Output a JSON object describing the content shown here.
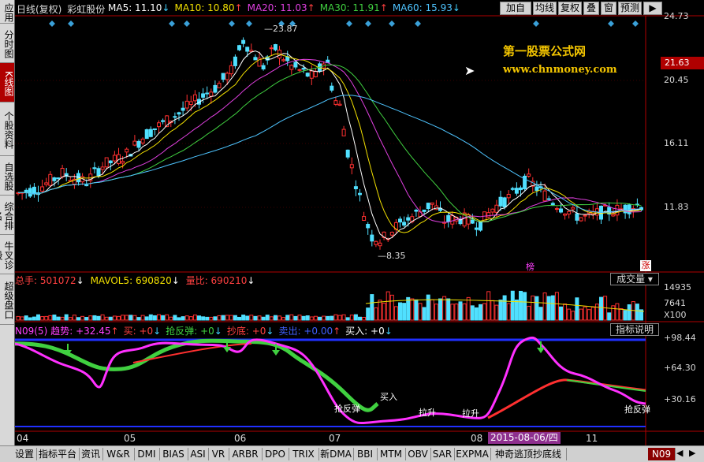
{
  "left_nav": [
    "应用",
    "分时图",
    "K线图",
    "个股资料",
    "自选股",
    "综合排名",
    "牛叉诊股",
    "超级盘口"
  ],
  "left_nav_active": 2,
  "header": {
    "title": "日线(复权)",
    "stock_name": "彩虹股份",
    "ma": [
      {
        "label": "MA5: 11.10",
        "arrow": "↓",
        "color": "#ffffff"
      },
      {
        "label": "MA10: 10.80",
        "arrow": "↑",
        "color": "#f2e000"
      },
      {
        "label": "MA20: 11.03",
        "arrow": "↑",
        "color": "#e040e0"
      },
      {
        "label": "MA30: 11.91",
        "arrow": "↑",
        "color": "#40d040"
      },
      {
        "label": "MA60: 15.93",
        "arrow": "↓",
        "color": "#4ec4ff"
      }
    ]
  },
  "toolbar": [
    "加自选",
    "均线",
    "复权",
    "叠",
    "窗",
    "预测",
    "▶"
  ],
  "price_axis": [
    "24.73",
    "20.45",
    "16.11",
    "11.83"
  ],
  "current_price": "21.63",
  "annotations": {
    "high": "23.87",
    "low": "8.35",
    "bang": "榜",
    "zhang": "涨"
  },
  "watermark": {
    "line1": "第一股票公式网",
    "line2": "www.chnmoney.com"
  },
  "volume_header": {
    "total": "总手: 501072",
    "total_arrow": "↓",
    "mavol": "MAVOL5: 690820",
    "mavol_arrow": "↓",
    "ratio": "量比: 690210",
    "ratio_arrow": "↓",
    "dropdown": "成交量"
  },
  "volume_axis": [
    "14935",
    "7641",
    "X100"
  ],
  "indicator_header": {
    "name": "N09(5)",
    "items": [
      {
        "label": "趋势: +32.45",
        "arrow": "↑",
        "color": "#ff40ff"
      },
      {
        "label": "买: +0",
        "arrow": "↓",
        "color": "#ff4040"
      },
      {
        "label": "抢反弹: +0",
        "arrow": "↓",
        "color": "#40d040"
      },
      {
        "label": "抄底: +0",
        "arrow": "↓",
        "color": "#ff4040"
      },
      {
        "label": "卖出: +0.00",
        "arrow": "↑",
        "color": "#4060ff"
      },
      {
        "label": "买入: +0",
        "arrow": "↓",
        "color": "#ffffff"
      }
    ],
    "help_button": "指标说明"
  },
  "indicator_axis": [
    "+98.44",
    "+64.30",
    "+30.16"
  ],
  "indicator_labels": [
    "抢反弹",
    "买入",
    "拉升",
    "拉升",
    "抢反弹"
  ],
  "date_axis": [
    "04",
    "05",
    "06",
    "07",
    "08",
    "11"
  ],
  "date_highlight": "2015-08-06/四",
  "bottom_tabs": [
    "设置",
    "指标平台",
    "资讯",
    "W&R",
    "DMI",
    "BIAS",
    "ASI",
    "VR",
    "ARBR",
    "DPO",
    "TRIX",
    "新DMA",
    "BBI",
    "MTM",
    "OBV",
    "SAR",
    "EXPMA",
    "神奇逃顶抄底线"
  ],
  "bottom_active": "N09",
  "colors": {
    "up": "#ff3030",
    "down": "#50e0ff",
    "ma5": "#ffffff",
    "ma10": "#f2e000",
    "ma20": "#e040e0",
    "ma30": "#40d040",
    "ma60": "#4ec4ff",
    "frame": "#b00000"
  }
}
